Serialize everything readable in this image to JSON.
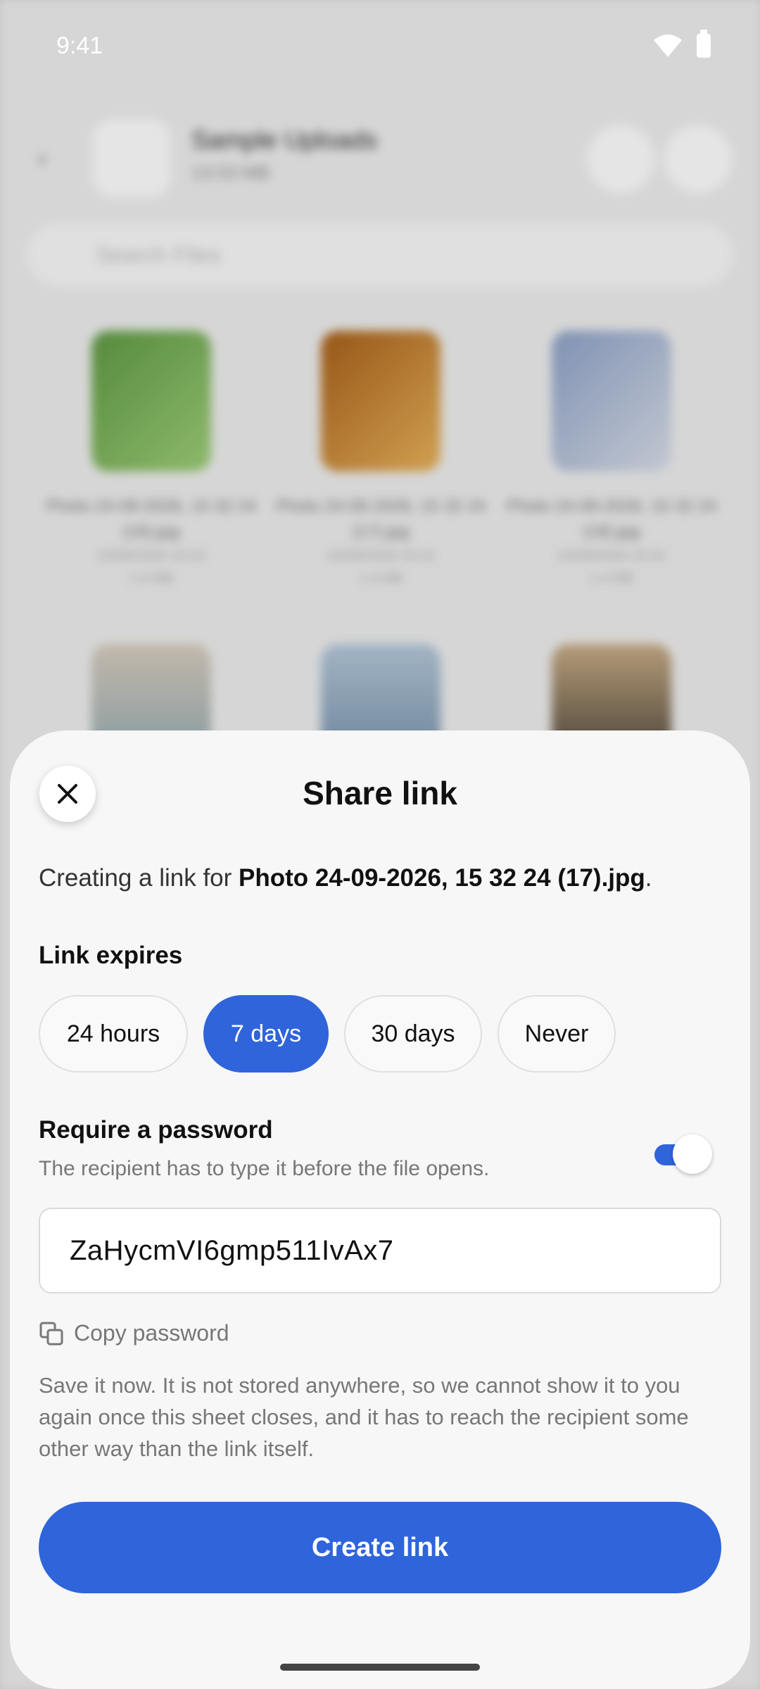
{
  "status_bar": {
    "time": "9:41",
    "wifi_icon": "wifi-icon",
    "battery_icon": "battery-icon"
  },
  "background": {
    "folder_title": "Sample Uploads",
    "folder_size": "13.53 MB",
    "search_placeholder": "Search Files",
    "files": [
      {
        "name": "Photo 24-09-2026, 15 32 24 (16).jpg",
        "meta": "24/09/2026 15:32",
        "size": "1.4 MB",
        "color1": "#5f9a44",
        "color2": "#9fcf78"
      },
      {
        "name": "Photo 24-09-2026, 15 32 24 (17).jpg",
        "meta": "24/09/2026 15:32",
        "size": "1.4 MB",
        "color1": "#a8601a",
        "color2": "#e9b45c"
      },
      {
        "name": "Photo 24-09-2026, 15 32 24 (18).jpg",
        "meta": "24/09/2026 15:32",
        "size": "1.4 MB",
        "color1": "#8ea2c8",
        "color2": "#d9dfe9"
      }
    ]
  },
  "sheet": {
    "title": "Share link",
    "intro_prefix": "Creating a link for ",
    "file_name": "Photo 24-09-2026, 15 32 24 (17).jpg",
    "intro_suffix": ".",
    "expires_label": "Link expires",
    "expiry_options": [
      {
        "label": "24 hours",
        "selected": false
      },
      {
        "label": "7 days",
        "selected": true
      },
      {
        "label": "30 days",
        "selected": false
      },
      {
        "label": "Never",
        "selected": false
      }
    ],
    "password_label": "Require a password",
    "password_description": "The recipient has to type it before the file opens.",
    "password_toggle_on": true,
    "password_value": "ZaHycmVI6gmp511IvAx7",
    "copy_label": "Copy password",
    "note": "Save it now. It is not stored anywhere, so we cannot show it to you again once this sheet closes, and it has to reach the recipient some other way than the link itself.",
    "create_button": "Create link"
  },
  "colors": {
    "accent": "#2f64da",
    "sheet_bg": "#f7f7f7"
  }
}
